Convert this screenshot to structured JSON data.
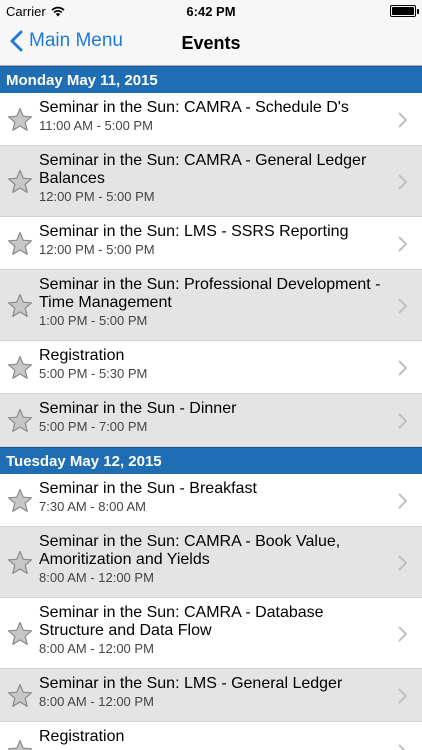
{
  "status": {
    "carrier": "Carrier",
    "time": "6:42 PM"
  },
  "nav": {
    "back_label": "Main Menu",
    "title": "Events"
  },
  "sections": [
    {
      "header": "Monday May 11, 2015",
      "events": [
        {
          "title": "Seminar in the Sun: CAMRA - Schedule D's",
          "time": "11:00 AM - 5:00 PM"
        },
        {
          "title": "Seminar in the Sun: CAMRA - General Ledger Balances",
          "time": "12:00 PM - 5:00 PM"
        },
        {
          "title": "Seminar in the Sun: LMS - SSRS Reporting",
          "time": "12:00 PM - 5:00 PM"
        },
        {
          "title": "Seminar in the Sun: Professional Development - Time Management",
          "time": "1:00 PM - 5:00 PM"
        },
        {
          "title": "Registration",
          "time": "5:00 PM - 5:30 PM"
        },
        {
          "title": "Seminar in the Sun - Dinner",
          "time": "5:00 PM - 7:00 PM"
        }
      ]
    },
    {
      "header": "Tuesday May 12, 2015",
      "events": [
        {
          "title": "Seminar in the Sun - Breakfast",
          "time": "7:30 AM - 8:00 AM"
        },
        {
          "title": "Seminar in the Sun: CAMRA - Book Value, Amoritization and Yields",
          "time": "8:00 AM - 12:00 PM"
        },
        {
          "title": "Seminar in the Sun: CAMRA - Database Structure and Data Flow",
          "time": "8:00 AM - 12:00 PM"
        },
        {
          "title": "Seminar in the Sun: LMS - General Ledger",
          "time": "8:00 AM - 12:00 PM"
        },
        {
          "title": "Registration",
          "time": ""
        }
      ]
    }
  ]
}
